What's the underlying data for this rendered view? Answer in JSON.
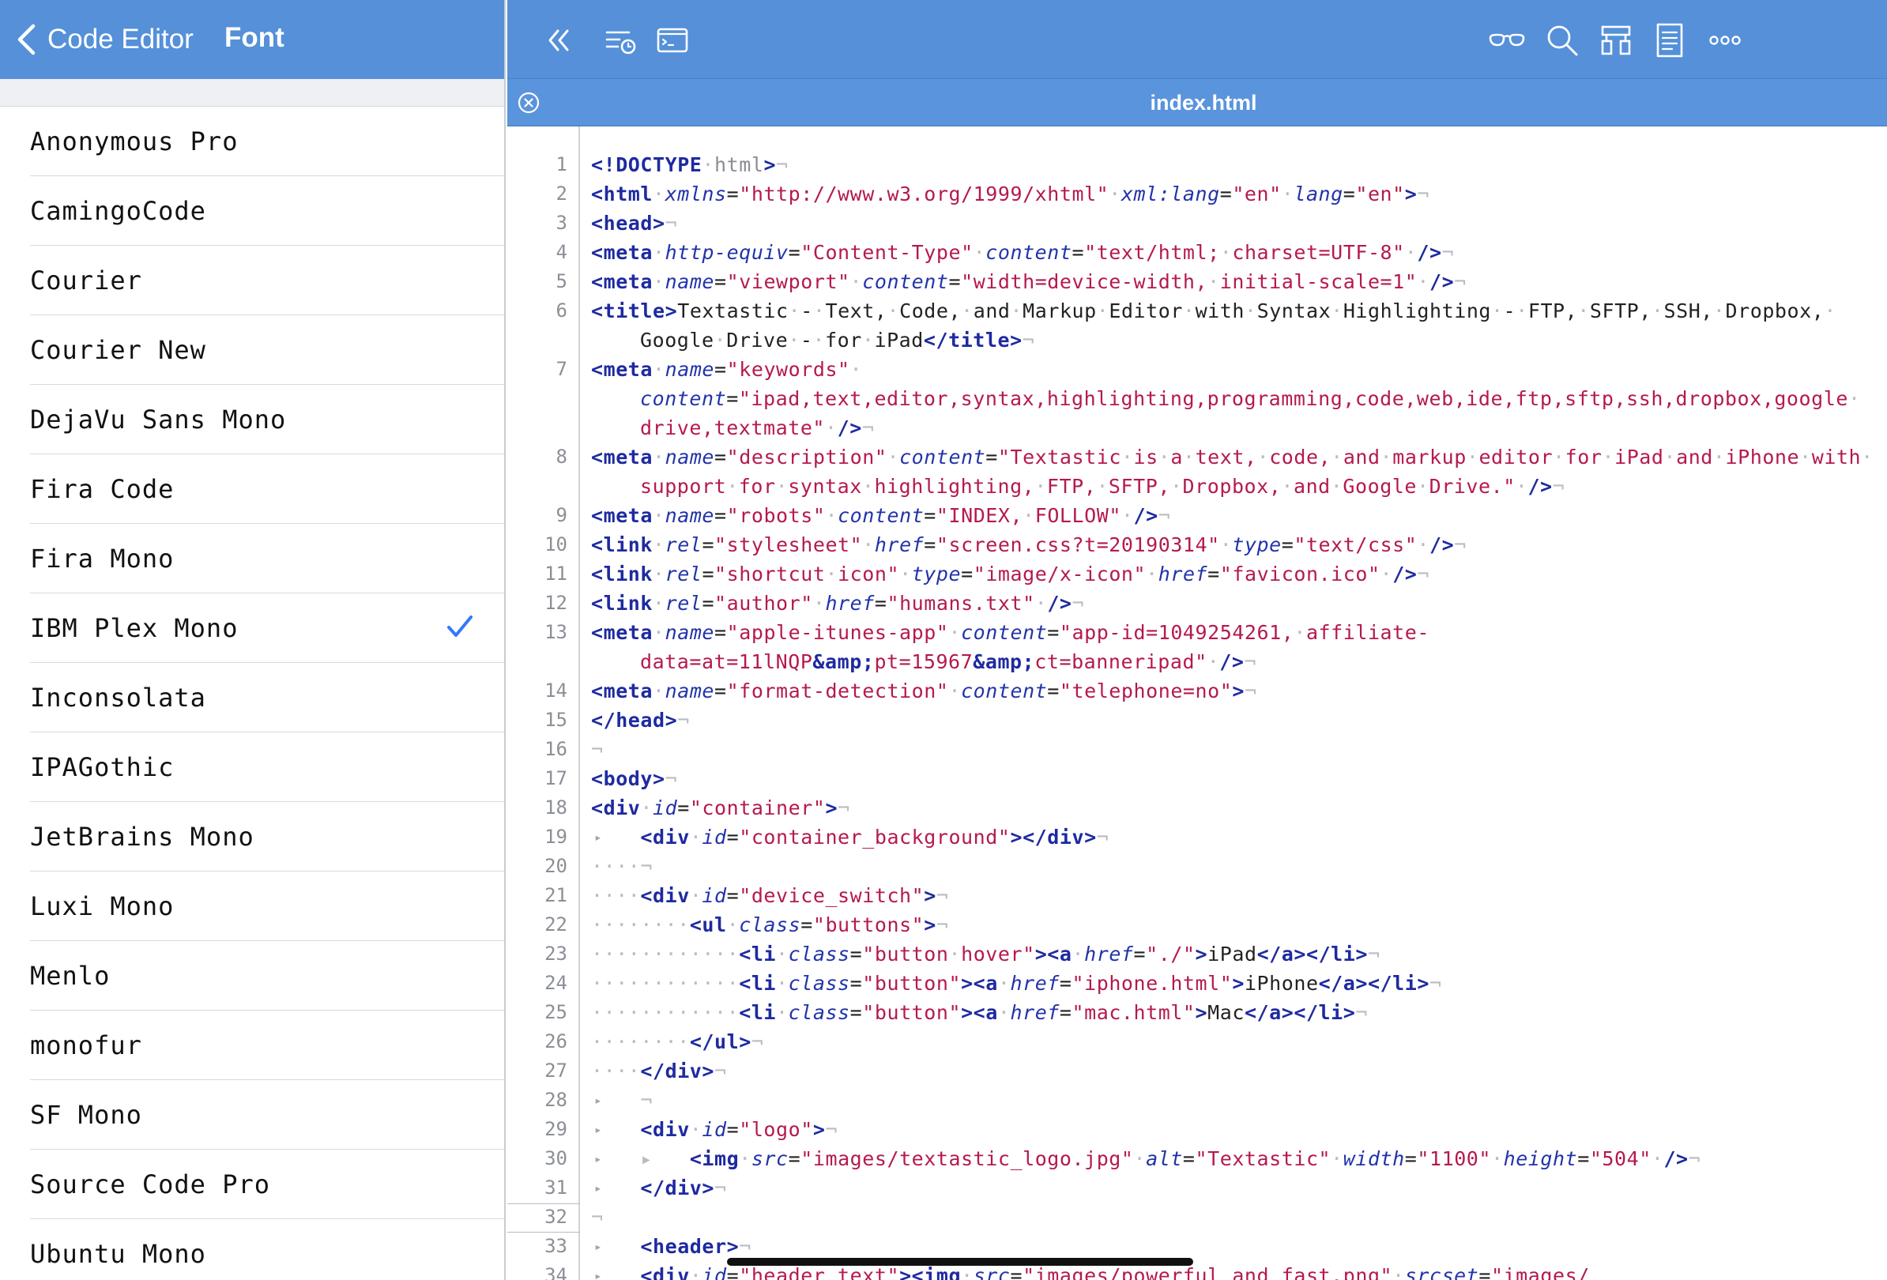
{
  "sidebar": {
    "back_label": "Code Editor",
    "title": "Font",
    "fonts": [
      {
        "label": "Anonymous Pro"
      },
      {
        "label": "CamingoCode"
      },
      {
        "label": "Courier"
      },
      {
        "label": "Courier New"
      },
      {
        "label": "DejaVu Sans Mono"
      },
      {
        "label": "Fira Code"
      },
      {
        "label": "Fira Mono"
      },
      {
        "label": "IBM Plex Mono",
        "selected": true
      },
      {
        "label": "Inconsolata"
      },
      {
        "label": "IPAGothic"
      },
      {
        "label": "JetBrains Mono"
      },
      {
        "label": "Luxi Mono"
      },
      {
        "label": "Menlo"
      },
      {
        "label": "monofur"
      },
      {
        "label": "SF Mono"
      },
      {
        "label": "Source Code Pro"
      },
      {
        "label": "Ubuntu Mono"
      }
    ]
  },
  "toolbar": {
    "icons": [
      "double-chevron-left-icon",
      "outline-history-icon",
      "terminal-icon",
      "glasses-icon",
      "search-icon",
      "structure-icon",
      "document-icon",
      "more-icon"
    ]
  },
  "tab": {
    "title": "index.html"
  },
  "editor": {
    "current_line": "32",
    "lines": [
      {
        "n": "1",
        "html": "<span class='t'>&lt;!DOCTYPE</span><span class='n'>·</span><span class='d'>html</span><span class='t'>&gt;</span><span class='n'>¬</span>"
      },
      {
        "n": "2",
        "html": "<span class='t'>&lt;html</span><span class='n'>·</span><span class='a'>xmlns</span>=<span class='s'>\"http://www.w3.org/1999/xhtml\"</span><span class='n'>·</span><span class='a'>xml:lang</span>=<span class='s'>\"en\"</span><span class='n'>·</span><span class='a'>lang</span>=<span class='s'>\"en\"</span><span class='t'>&gt;</span><span class='n'>¬</span>"
      },
      {
        "n": "3",
        "html": "<span class='t'>&lt;head&gt;</span><span class='n'>¬</span>"
      },
      {
        "n": "4",
        "html": "<span class='t'>&lt;meta</span><span class='n'>·</span><span class='a'>http-equiv</span>=<span class='s'>\"Content-Type\"</span><span class='n'>·</span><span class='a'>content</span>=<span class='s'>\"text/html;<span class='n'>·</span>charset=UTF-8\"</span><span class='n'>·</span><span class='t'>/&gt;</span><span class='n'>¬</span>"
      },
      {
        "n": "5",
        "html": "<span class='t'>&lt;meta</span><span class='n'>·</span><span class='a'>name</span>=<span class='s'>\"viewport\"</span><span class='n'>·</span><span class='a'>content</span>=<span class='s'>\"width=device-width,<span class='n'>·</span>initial-scale=1\"</span><span class='n'>·</span><span class='t'>/&gt;</span><span class='n'>¬</span>"
      },
      {
        "n": "6",
        "html": "<span class='t'>&lt;title&gt;</span>Textastic<span class='n'>·</span>-<span class='n'>·</span>Text,<span class='n'>·</span>Code,<span class='n'>·</span>and<span class='n'>·</span>Markup<span class='n'>·</span>Editor<span class='n'>·</span>with<span class='n'>·</span>Syntax<span class='n'>·</span>Highlighting<span class='n'>·</span>-<span class='n'>·</span>FTP,<span class='n'>·</span>SFTP,<span class='n'>·</span>SSH,<span class='n'>·</span>Dropbox,<span class='n'>·</span>"
      },
      {
        "n": "",
        "wrap": true,
        "html": "Google<span class='n'>·</span>Drive<span class='n'>·</span>-<span class='n'>·</span>for<span class='n'>·</span>iPad<span class='t'>&lt;/title&gt;</span><span class='n'>¬</span>"
      },
      {
        "n": "7",
        "html": "<span class='t'>&lt;meta</span><span class='n'>·</span><span class='a'>name</span>=<span class='s'>\"keywords\"</span><span class='n'>·</span>"
      },
      {
        "n": "",
        "wrap": true,
        "html": "<span class='a'>content</span>=<span class='s'>\"ipad,text,editor,syntax,highlighting,programming,code,web,ide,ftp,sftp,ssh,dropbox,google</span><span class='n'>·</span>"
      },
      {
        "n": "",
        "wrap": true,
        "html": "<span class='s'>drive,textmate\"</span><span class='n'>·</span><span class='t'>/&gt;</span><span class='n'>¬</span>"
      },
      {
        "n": "8",
        "html": "<span class='t'>&lt;meta</span><span class='n'>·</span><span class='a'>name</span>=<span class='s'>\"description\"</span><span class='n'>·</span><span class='a'>content</span>=<span class='s'>\"Textastic<span class='n'>·</span>is<span class='n'>·</span>a<span class='n'>·</span>text,<span class='n'>·</span>code,<span class='n'>·</span>and<span class='n'>·</span>markup<span class='n'>·</span>editor<span class='n'>·</span>for<span class='n'>·</span>iPad<span class='n'>·</span>and<span class='n'>·</span>iPhone<span class='n'>·</span>with</span><span class='n'>·</span>"
      },
      {
        "n": "",
        "wrap": true,
        "html": "<span class='s'>support<span class='n'>·</span>for<span class='n'>·</span>syntax<span class='n'>·</span>highlighting,<span class='n'>·</span>FTP,<span class='n'>·</span>SFTP,<span class='n'>·</span>Dropbox,<span class='n'>·</span>and<span class='n'>·</span>Google<span class='n'>·</span>Drive.\"</span><span class='n'>·</span><span class='t'>/&gt;</span><span class='n'>¬</span>"
      },
      {
        "n": "9",
        "html": "<span class='t'>&lt;meta</span><span class='n'>·</span><span class='a'>name</span>=<span class='s'>\"robots\"</span><span class='n'>·</span><span class='a'>content</span>=<span class='s'>\"INDEX,<span class='n'>·</span>FOLLOW\"</span><span class='n'>·</span><span class='t'>/&gt;</span><span class='n'>¬</span>"
      },
      {
        "n": "10",
        "html": "<span class='t'>&lt;link</span><span class='n'>·</span><span class='a'>rel</span>=<span class='s'>\"stylesheet\"</span><span class='n'>·</span><span class='a'>href</span>=<span class='s'>\"screen.css?t=20190314\"</span><span class='n'>·</span><span class='a'>type</span>=<span class='s'>\"text/css\"</span><span class='n'>·</span><span class='t'>/&gt;</span><span class='n'>¬</span>"
      },
      {
        "n": "11",
        "html": "<span class='t'>&lt;link</span><span class='n'>·</span><span class='a'>rel</span>=<span class='s'>\"shortcut<span class='n'>·</span>icon\"</span><span class='n'>·</span><span class='a'>type</span>=<span class='s'>\"image/x-icon\"</span><span class='n'>·</span><span class='a'>href</span>=<span class='s'>\"favicon.ico\"</span><span class='n'>·</span><span class='t'>/&gt;</span><span class='n'>¬</span>"
      },
      {
        "n": "12",
        "html": "<span class='t'>&lt;link</span><span class='n'>·</span><span class='a'>rel</span>=<span class='s'>\"author\"</span><span class='n'>·</span><span class='a'>href</span>=<span class='s'>\"humans.txt\"</span><span class='n'>·</span><span class='t'>/&gt;</span><span class='n'>¬</span>"
      },
      {
        "n": "13",
        "html": "<span class='t'>&lt;meta</span><span class='n'>·</span><span class='a'>name</span>=<span class='s'>\"apple-itunes-app\"</span><span class='n'>·</span><span class='a'>content</span>=<span class='s'>\"app-id=1049254261,<span class='n'>·</span>affiliate-</span>"
      },
      {
        "n": "",
        "wrap": true,
        "html": "<span class='s'>data=at=11lNQP</span><span class='e'>&amp;amp;</span><span class='s'>pt=15967</span><span class='e'>&amp;amp;</span><span class='s'>ct=banneripad\"</span><span class='n'>·</span><span class='t'>/&gt;</span><span class='n'>¬</span>"
      },
      {
        "n": "14",
        "html": "<span class='t'>&lt;meta</span><span class='n'>·</span><span class='a'>name</span>=<span class='s'>\"format-detection\"</span><span class='n'>·</span><span class='a'>content</span>=<span class='s'>\"telephone=no\"</span><span class='t'>&gt;</span><span class='n'>¬</span>"
      },
      {
        "n": "15",
        "html": "<span class='t'>&lt;/head&gt;</span><span class='n'>¬</span>"
      },
      {
        "n": "16",
        "html": "<span class='n'>¬</span>"
      },
      {
        "n": "17",
        "html": "<span class='t'>&lt;body&gt;</span><span class='n'>¬</span>"
      },
      {
        "n": "18",
        "html": "<span class='t'>&lt;div</span><span class='n'>·</span><span class='a'>id</span>=<span class='s'>\"container\"</span><span class='t'>&gt;</span><span class='n'>¬</span>"
      },
      {
        "n": "19",
        "fold": true,
        "html": "    <span class='t'>&lt;div</span><span class='n'>·</span><span class='a'>id</span>=<span class='s'>\"container_background\"</span><span class='t'>&gt;&lt;/div&gt;</span><span class='n'>¬</span>"
      },
      {
        "n": "20",
        "html": "<span class='n'>····¬</span>"
      },
      {
        "n": "21",
        "html": "<span class='n'>····</span><span class='t'>&lt;div</span><span class='n'>·</span><span class='a'>id</span>=<span class='s'>\"device_switch\"</span><span class='t'>&gt;</span><span class='n'>¬</span>"
      },
      {
        "n": "22",
        "html": "<span class='n'>········</span><span class='t'>&lt;ul</span><span class='n'>·</span><span class='a'>class</span>=<span class='s'>\"buttons\"</span><span class='t'>&gt;</span><span class='n'>¬</span>"
      },
      {
        "n": "23",
        "html": "<span class='n'>············</span><span class='t'>&lt;li</span><span class='n'>·</span><span class='a'>class</span>=<span class='s'>\"button<span class='n'>·</span>hover\"</span><span class='t'>&gt;&lt;a</span><span class='n'>·</span><span class='a'>href</span>=<span class='s'>\"./\"</span><span class='t'>&gt;</span>iPad<span class='t'>&lt;/a&gt;&lt;/li&gt;</span><span class='n'>¬</span>"
      },
      {
        "n": "24",
        "html": "<span class='n'>············</span><span class='t'>&lt;li</span><span class='n'>·</span><span class='a'>class</span>=<span class='s'>\"button\"</span><span class='t'>&gt;&lt;a</span><span class='n'>·</span><span class='a'>href</span>=<span class='s'>\"iphone.html\"</span><span class='t'>&gt;</span>iPhone<span class='t'>&lt;/a&gt;&lt;/li&gt;</span><span class='n'>¬</span>"
      },
      {
        "n": "25",
        "html": "<span class='n'>············</span><span class='t'>&lt;li</span><span class='n'>·</span><span class='a'>class</span>=<span class='s'>\"button\"</span><span class='t'>&gt;&lt;a</span><span class='n'>·</span><span class='a'>href</span>=<span class='s'>\"mac.html\"</span><span class='t'>&gt;</span>Mac<span class='t'>&lt;/a&gt;&lt;/li&gt;</span><span class='n'>¬</span>"
      },
      {
        "n": "26",
        "html": "<span class='n'>········</span><span class='t'>&lt;/ul&gt;</span><span class='n'>¬</span>"
      },
      {
        "n": "27",
        "html": "<span class='n'>····</span><span class='t'>&lt;/div&gt;</span><span class='n'>¬</span>"
      },
      {
        "n": "28",
        "fold": true,
        "html": "    <span class='n'>¬</span>"
      },
      {
        "n": "29",
        "fold": true,
        "html": "    <span class='t'>&lt;div</span><span class='n'>·</span><span class='a'>id</span>=<span class='s'>\"logo\"</span><span class='t'>&gt;</span><span class='n'>¬</span>"
      },
      {
        "n": "30",
        "fold": true,
        "html": "    <span class='n'>▸</span>   <span class='t'>&lt;img</span><span class='n'>·</span><span class='a'>src</span>=<span class='s'>\"images/textastic_logo.jpg\"</span><span class='n'>·</span><span class='a'>alt</span>=<span class='s'>\"Textastic\"</span><span class='n'>·</span><span class='a'>width</span>=<span class='s'>\"1100\"</span><span class='n'>·</span><span class='a'>height</span>=<span class='s'>\"504\"</span><span class='n'>·</span><span class='t'>/&gt;</span><span class='n'>¬</span>"
      },
      {
        "n": "31",
        "fold": true,
        "html": "    <span class='t'>&lt;/div&gt;</span><span class='n'>¬</span>"
      },
      {
        "n": "32",
        "html": "<span class='n'>¬</span>"
      },
      {
        "n": "33",
        "fold": true,
        "html": "    <span class='t'>&lt;header&gt;</span><span class='n'>¬</span>"
      },
      {
        "n": "34",
        "fold": true,
        "html": "    <span class='t'>&lt;div</span><span class='n'>·</span><span class='a'>id</span>=<span class='s'>\"header_text\"</span><span class='t'>&gt;&lt;img</span><span class='n'>·</span><span class='a'>src</span>=<span class='s'>\"images/powerful_and_fast.png\"</span><span class='n'>·</span><span class='a'>srcset</span>=<span class='s'>\"images/</span>"
      }
    ]
  }
}
